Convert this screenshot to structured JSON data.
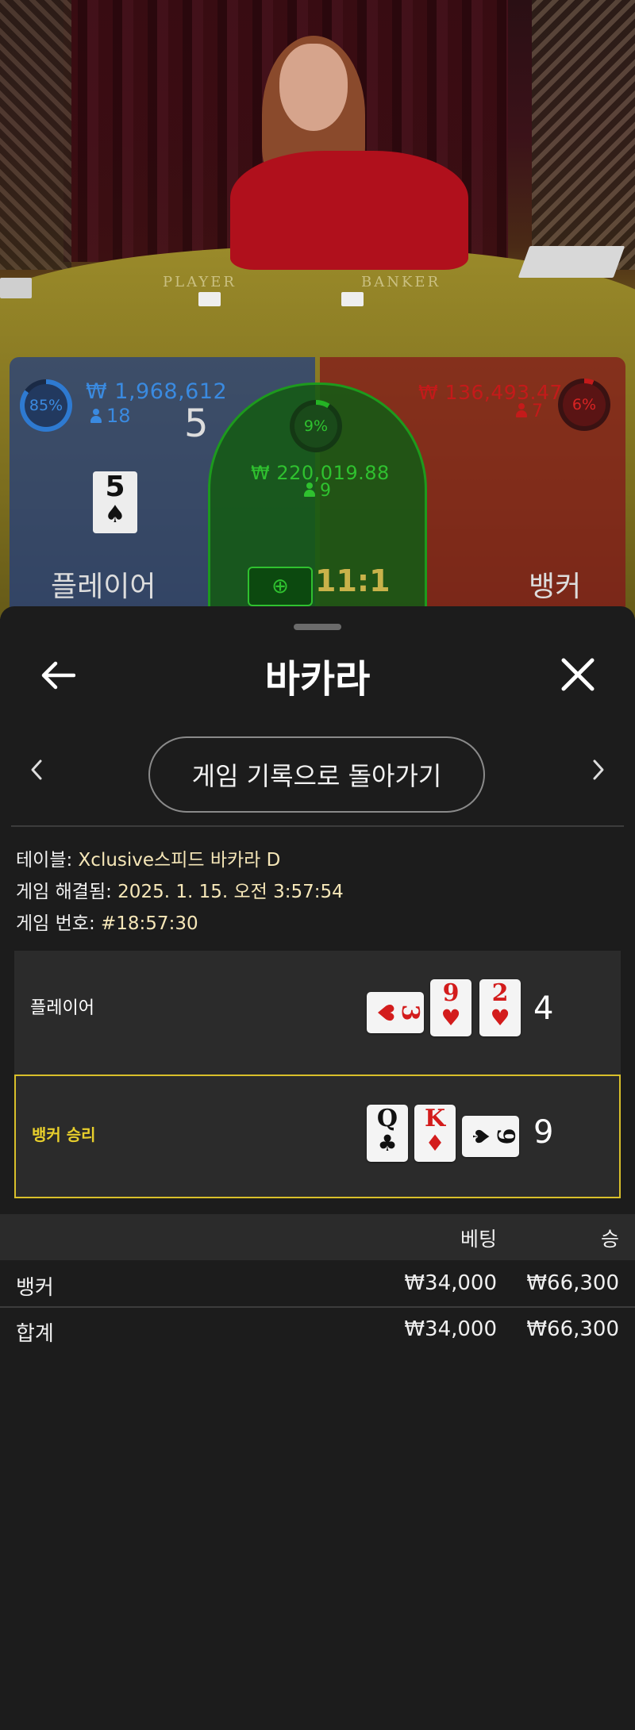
{
  "video": {
    "felt_labels": [
      "PLAYER",
      "BANKER"
    ],
    "player": {
      "percent": "85%",
      "amount": "₩ 1,968,612",
      "count": "18",
      "score": "5",
      "card_rank": "5",
      "card_suit": "♠",
      "label": "플레이어"
    },
    "tie": {
      "percent": "9%",
      "amount": "₩ 220,019.88",
      "count": "9",
      "odds": "11:1"
    },
    "banker": {
      "percent": "6%",
      "amount": "₩ 136,493.47",
      "count": "7",
      "label": "뱅커"
    },
    "colors": {
      "player": "#2e7ad1",
      "tie": "#24b324",
      "banker": "#c41a1a"
    }
  },
  "sheet": {
    "title": "바카라",
    "back_icon": "arrow-left-icon",
    "close_icon": "close-icon",
    "history_button": "게임 기록으로 돌아가기",
    "info": {
      "table_label": "테이블: ",
      "table_value": "Xclusive스피드 바카라 D",
      "resolved_label": "게임 해결됨: ",
      "resolved_value": "2025. 1. 15. 오전 3:57:54",
      "round_label": "게임 번호: ",
      "round_value": "#18:57:30"
    },
    "hands": [
      {
        "label": "플레이어",
        "winner": false,
        "score": "4",
        "cards": [
          {
            "rank": "3",
            "suit": "♥",
            "orientation": "horizontal"
          },
          {
            "rank": "9",
            "suit": "♥",
            "orientation": "vertical"
          },
          {
            "rank": "2",
            "suit": "♥",
            "orientation": "vertical"
          }
        ]
      },
      {
        "label": "뱅커 승리",
        "winner": true,
        "score": "9",
        "cards": [
          {
            "rank": "Q",
            "suit": "♣",
            "orientation": "vertical"
          },
          {
            "rank": "K",
            "suit": "♦",
            "orientation": "vertical"
          },
          {
            "rank": "9",
            "suit": "♠",
            "orientation": "horizontal"
          }
        ]
      }
    ],
    "bets": {
      "headers": [
        "베팅",
        "승"
      ],
      "rows": [
        {
          "label": "뱅커",
          "bet": "₩34,000",
          "win": "₩66,300"
        },
        {
          "label": "합계",
          "bet": "₩34,000",
          "win": "₩66,300"
        }
      ]
    },
    "colors": {
      "winner": "#e8cf2c",
      "panel": "#2b2b2b"
    }
  }
}
